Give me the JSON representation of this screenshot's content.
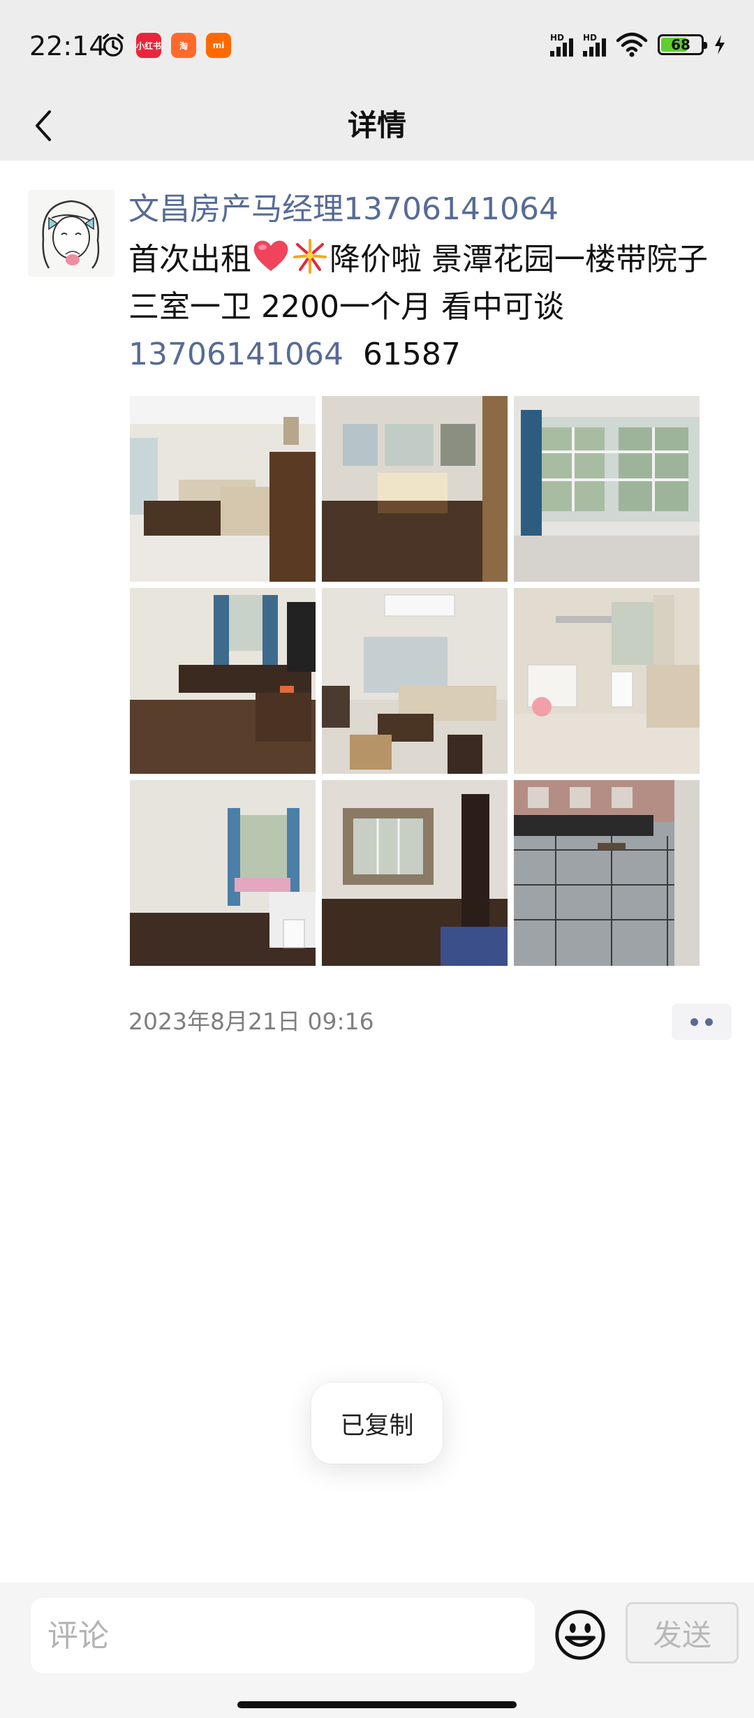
{
  "status_bar": {
    "time": "22:14",
    "app_icons": [
      {
        "name": "xiaohongshu",
        "label": "小红书",
        "color": "#e8263b"
      },
      {
        "name": "taobao",
        "label": "淘",
        "color": "#ff6a2a"
      },
      {
        "name": "xiaomi",
        "label": "mi",
        "color": "#ff6a00"
      }
    ],
    "signal_labels": [
      "HD",
      "HD"
    ],
    "battery_level": "68",
    "battery_fraction": 0.68
  },
  "navbar": {
    "back_icon": "chevron-left-icon",
    "title": "详情"
  },
  "post": {
    "author": "文昌房产马经理13706141064",
    "content_text_1": "首次出租",
    "content_text_2": "降价啦  景潭花园一楼带院子  三室一卫  2200一个月  看中可谈",
    "phone": "13706141064",
    "content_text_3": "61587",
    "photos": [
      {
        "name": "living-room-sofa",
        "icon": "photo"
      },
      {
        "name": "bedroom-bed",
        "icon": "photo"
      },
      {
        "name": "window-room",
        "icon": "photo"
      },
      {
        "name": "room-tv-cabinet",
        "icon": "photo"
      },
      {
        "name": "living-room-ceiling-light",
        "icon": "photo"
      },
      {
        "name": "bathroom",
        "icon": "photo"
      },
      {
        "name": "bedroom-window",
        "icon": "photo"
      },
      {
        "name": "empty-room-bay-window",
        "icon": "photo"
      },
      {
        "name": "courtyard",
        "icon": "photo"
      }
    ],
    "timestamp": "2023年8月21日 09:16"
  },
  "toast": {
    "text": "已复制"
  },
  "comment_bar": {
    "placeholder": "评论",
    "emoji_icon": "smiley-icon",
    "send_label": "发送"
  },
  "colors": {
    "link": "#576b95",
    "header_bg": "#ededed",
    "battery_green": "#5ecf2f"
  }
}
